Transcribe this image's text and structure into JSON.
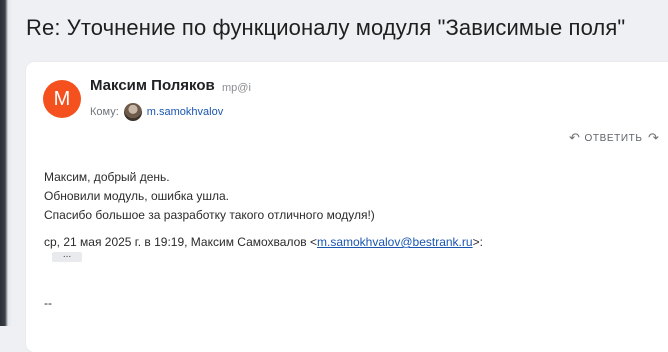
{
  "subject": "Re: Уточнение по функционалу модуля \"Зависимые поля\"",
  "message": {
    "sender_initial": "М",
    "sender_name": "Максим Поляков",
    "sender_email": "mp@i",
    "to_label": "Кому:",
    "to_name": "m.samokhvalov",
    "reply_label": "ОТВЕТИТЬ",
    "reply_icon": "reply-icon",
    "forward_icon": "forward-icon",
    "body_lines": [
      "Максим, добрый день.",
      "Обновили модуль, ошибка ушла.",
      "Спасибо большое за разработку такого отличного модуля!)"
    ],
    "quote_prefix": "ср, 21 мая 2025 г. в 19:19, Максим Самохвалов <",
    "quote_email": "m.samokhvalov@bestrank.ru",
    "quote_suffix": ">:",
    "show_quote_label": "...",
    "signature": "--"
  },
  "colors": {
    "avatar_bg": "#f4511e",
    "link": "#1a56b0",
    "background": "#eef0f3",
    "card": "#ffffff"
  }
}
